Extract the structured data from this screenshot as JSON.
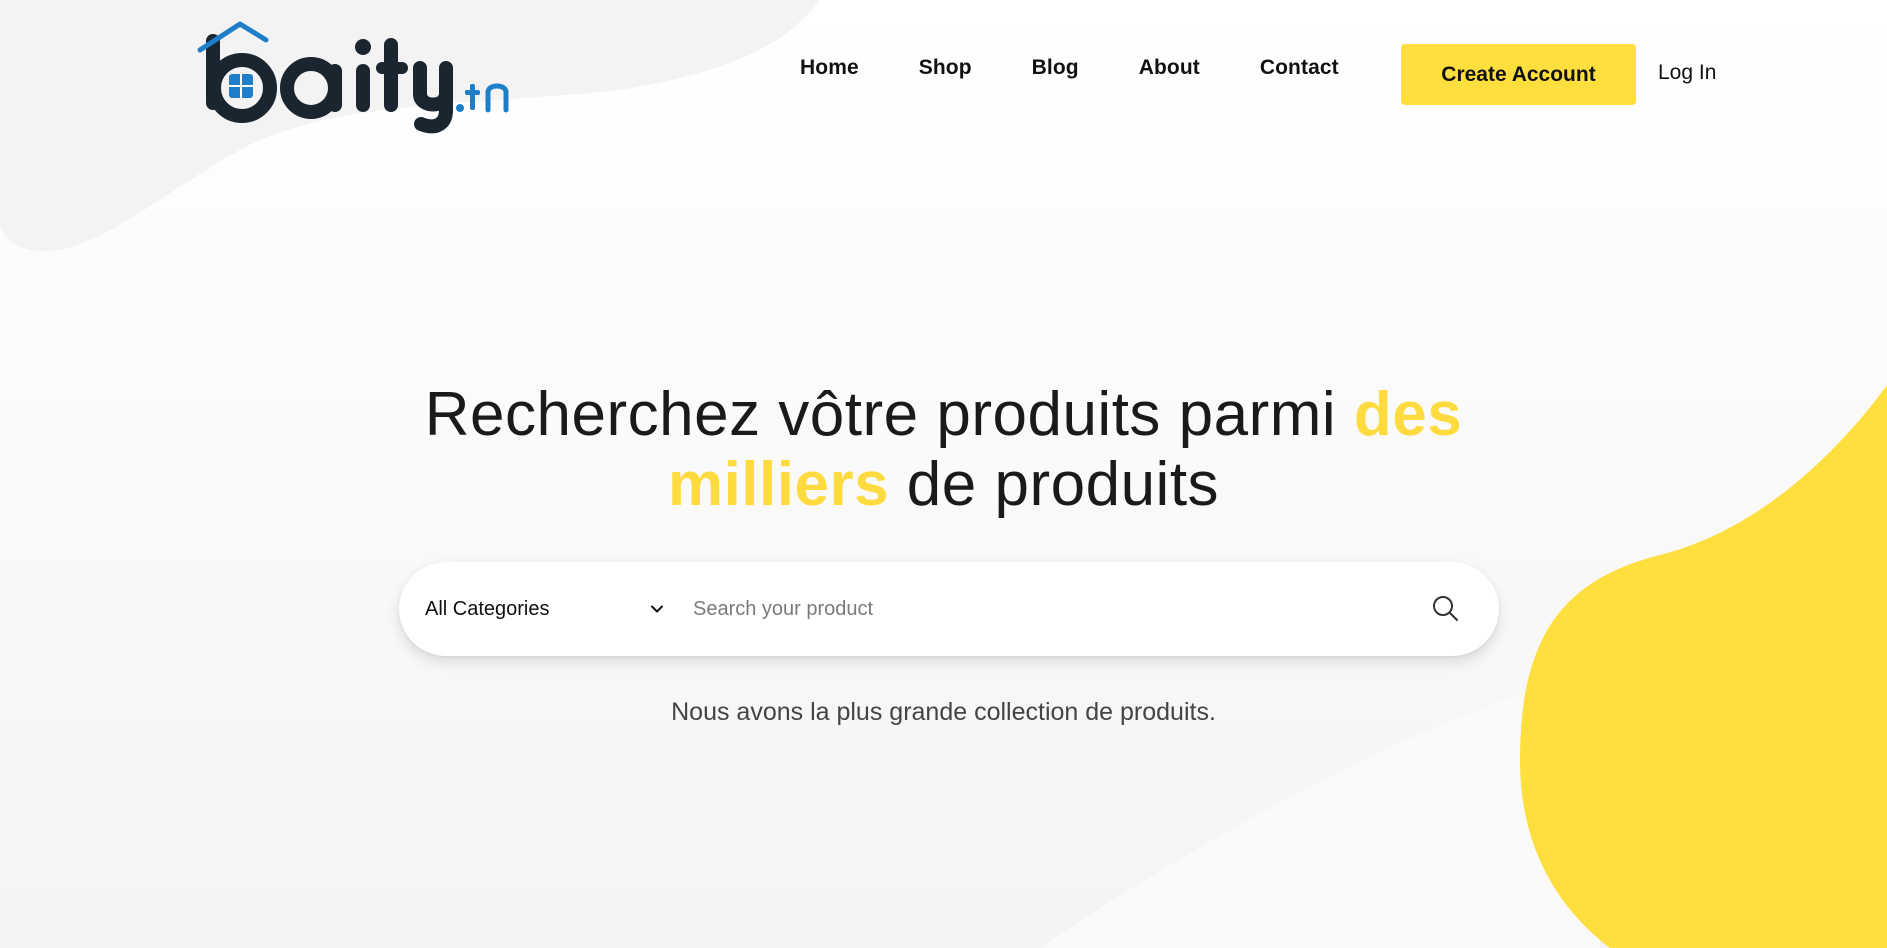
{
  "brand": {
    "logo_text": "baity",
    "logo_tld": ".tn",
    "logo_dark_color": "#1a2530",
    "logo_blue_color": "#1e7fc8"
  },
  "nav": {
    "items": [
      {
        "label": "Home"
      },
      {
        "label": "Shop"
      },
      {
        "label": "Blog"
      },
      {
        "label": "About"
      },
      {
        "label": "Contact"
      }
    ],
    "create_account_label": "Create Account",
    "login_label": "Log In"
  },
  "hero": {
    "title_part1": "Recherchez vôtre produits parmi ",
    "title_highlight": "des milliers",
    "title_part2": " de produits",
    "subtitle": "Nous avons la plus grande collection de produits."
  },
  "search": {
    "category_selected": "All Categories",
    "placeholder": "Search your product",
    "category_icon": "chevron-down-icon",
    "submit_icon": "search-icon"
  },
  "colors": {
    "accent_yellow": "#ffdf3e",
    "text_dark": "#111111"
  }
}
